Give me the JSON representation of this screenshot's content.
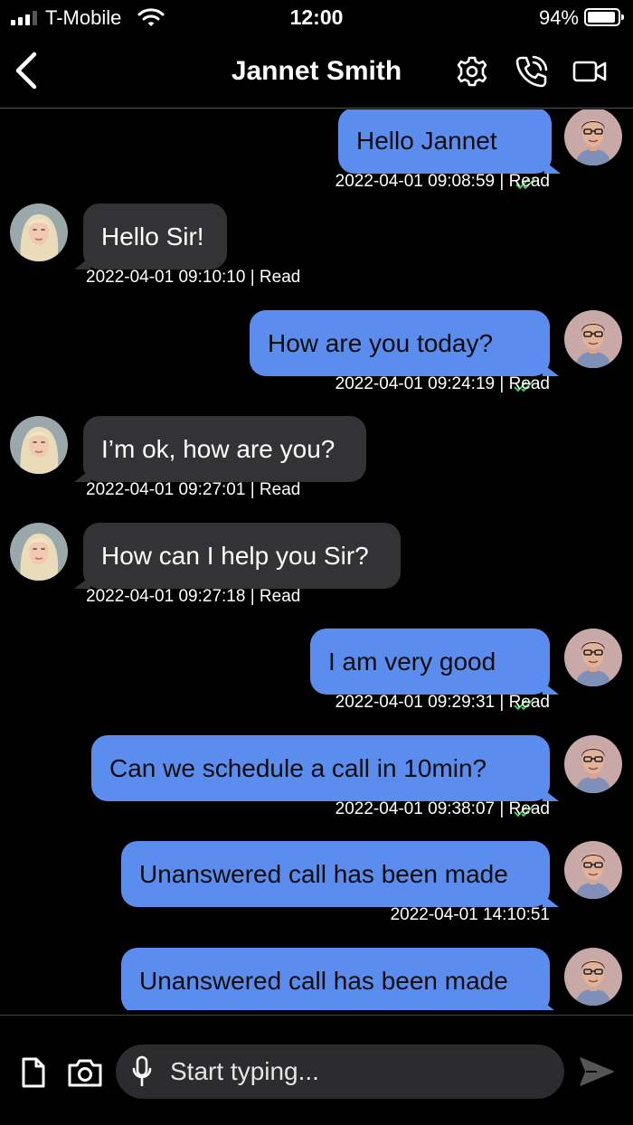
{
  "status_bar": {
    "carrier": "T-Mobile",
    "time": "12:00",
    "battery": "94%",
    "battery_level": 0.94,
    "signal_bars": 3
  },
  "header": {
    "title": "Jannet Smith",
    "icons": [
      "back-icon",
      "gear-icon",
      "phone-call-icon",
      "video-icon"
    ]
  },
  "colors": {
    "outgoing_bubble": "#5b8def",
    "incoming_bubble": "#333335",
    "read_ticks": "#4cd964",
    "background": "#000000"
  },
  "messages": [
    {
      "direction": "out",
      "text": "Hello Jannet",
      "timestamp": "2022-04-01 09:08:59 | Read",
      "read": true
    },
    {
      "direction": "in",
      "text": "Hello Sir!",
      "timestamp": "2022-04-01 09:10:10 | Read"
    },
    {
      "direction": "out",
      "text": "How are you today?",
      "timestamp": "2022-04-01 09:24:19 | Read",
      "read": true
    },
    {
      "direction": "in",
      "text": "I’m ok, how are you?",
      "timestamp": "2022-04-01 09:27:01 | Read"
    },
    {
      "direction": "in",
      "text": "How can I help you Sir?",
      "timestamp": "2022-04-01 09:27:18 | Read"
    },
    {
      "direction": "out",
      "text": "I am very good",
      "timestamp": "2022-04-01 09:29:31 | Read",
      "read": true
    },
    {
      "direction": "out",
      "text": "Can we schedule a call in 10min?",
      "timestamp": "2022-04-01 09:38:07 | Read",
      "read": true
    },
    {
      "direction": "out",
      "text": "Unanswered call has been made",
      "timestamp": "2022-04-01 14:10:51"
    },
    {
      "direction": "out",
      "text": "Unanswered call has been made",
      "timestamp": ""
    }
  ],
  "composer": {
    "placeholder": "Start typing...",
    "icons": [
      "file-icon",
      "camera-icon",
      "microphone-icon",
      "send-icon"
    ]
  }
}
